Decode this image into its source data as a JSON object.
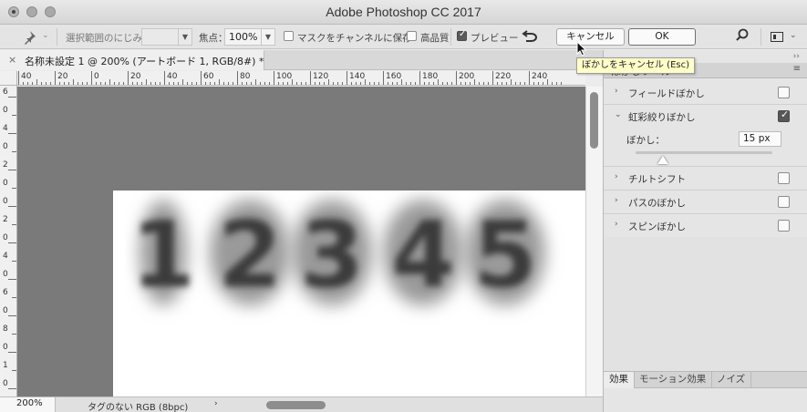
{
  "window": {
    "title": "Adobe Photoshop CC 2017"
  },
  "options_bar": {
    "selection_bleed_label": "選択範囲のにじみ：",
    "selection_bleed_value": "",
    "focus_label": "焦点：",
    "focus_value": "100%",
    "save_mask_label": "マスクをチャンネルに保存",
    "high_quality_label": "高品質",
    "preview_label": "プレビュー",
    "preview_checked": true,
    "cancel_label": "キャンセル",
    "ok_label": "OK"
  },
  "tooltip": {
    "text": "ぼかしをキャンセル (Esc)"
  },
  "document_tab": {
    "close_glyph": "×",
    "title": "名称未設定 1 @ 200% (アートボード 1, RGB/8#) *"
  },
  "ruler_h": [
    "40",
    "20",
    "0",
    "20",
    "40",
    "60",
    "80",
    "100",
    "120",
    "140",
    "160",
    "180",
    "200",
    "220",
    "240"
  ],
  "ruler_v": [
    "6",
    "0",
    "4",
    "0",
    "2",
    "0",
    "0",
    "2",
    "0",
    "4",
    "0",
    "6",
    "0",
    "8",
    "0",
    "1",
    "0"
  ],
  "artwork": {
    "digits": [
      "1",
      "2",
      "3",
      "4",
      "5"
    ]
  },
  "status_bar": {
    "zoom": "200%",
    "doc_info": "タグのない RGB (8bpc)",
    "arrow": "›"
  },
  "blur_panel": {
    "header_title": "ぼかしツール",
    "collapse_glyph": "››",
    "items": [
      {
        "label": "フィールドぼかし",
        "expanded": false,
        "checked": false
      },
      {
        "label": "虹彩絞りぼかし",
        "expanded": true,
        "checked": true
      },
      {
        "label": "チルトシフト",
        "expanded": false,
        "checked": false
      },
      {
        "label": "パスのぼかし",
        "expanded": false,
        "checked": false
      },
      {
        "label": "スピンぼかし",
        "expanded": false,
        "checked": false
      }
    ],
    "iris_param_label": "ぼかし：",
    "iris_param_value": "15 px",
    "iris_slider_fraction": 0.2
  },
  "bottom_tabs": [
    "効果",
    "モーション効果",
    "ノイズ"
  ],
  "icons": {
    "pin": "pin-icon",
    "undo": "undo-icon",
    "search": "search-icon",
    "workspace": "workspace-icon"
  }
}
